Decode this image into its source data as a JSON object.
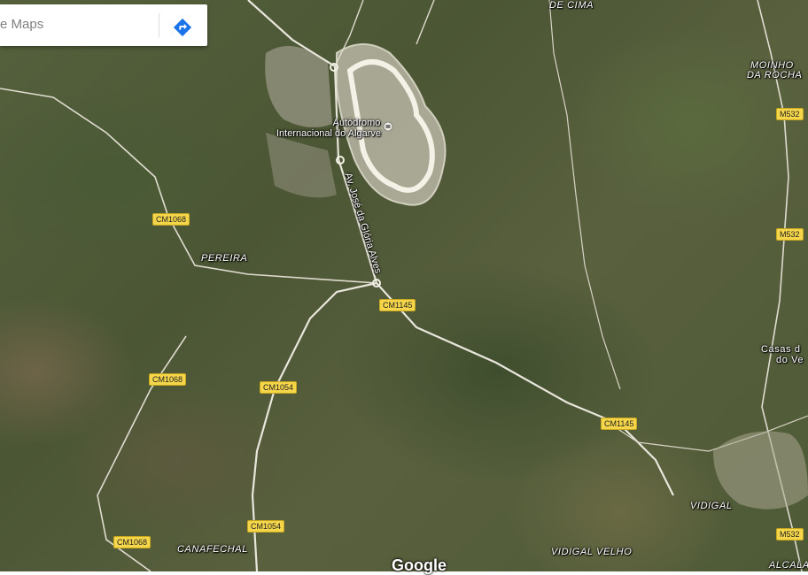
{
  "search": {
    "text": "e Maps"
  },
  "places": {
    "de_cima": "DE CIMA",
    "moinho_da_rocha_1": "MOINHO",
    "moinho_da_rocha_2": "DA ROCHA",
    "pereira": "PEREIRA",
    "casas_1": "Casas d",
    "casas_2": "do Ve",
    "vidigal": "VIDIGAL",
    "canafechal": "CANAFECHAL",
    "vidigal_velho": "VIDIGAL VELHO",
    "alcala": "ALCALA"
  },
  "poi": {
    "name_line1": "Autódromo",
    "name_line2": "Internacional do Algarve"
  },
  "street": {
    "name": "Av. José da Glória Alves"
  },
  "roads": {
    "m532_a": "M532",
    "m532_b": "M532",
    "m532_c": "M532",
    "cm1068_a": "CM1068",
    "cm1068_b": "CM1068",
    "cm1068_c": "CM1068",
    "cm1145_a": "CM1145",
    "cm1145_b": "CM1145",
    "cm1054_a": "CM1054",
    "cm1054_b": "CM1054"
  },
  "branding": {
    "logo": "Google"
  },
  "colors": {
    "badge": "#f5d64a",
    "direction_icon": "#1a73e8"
  }
}
